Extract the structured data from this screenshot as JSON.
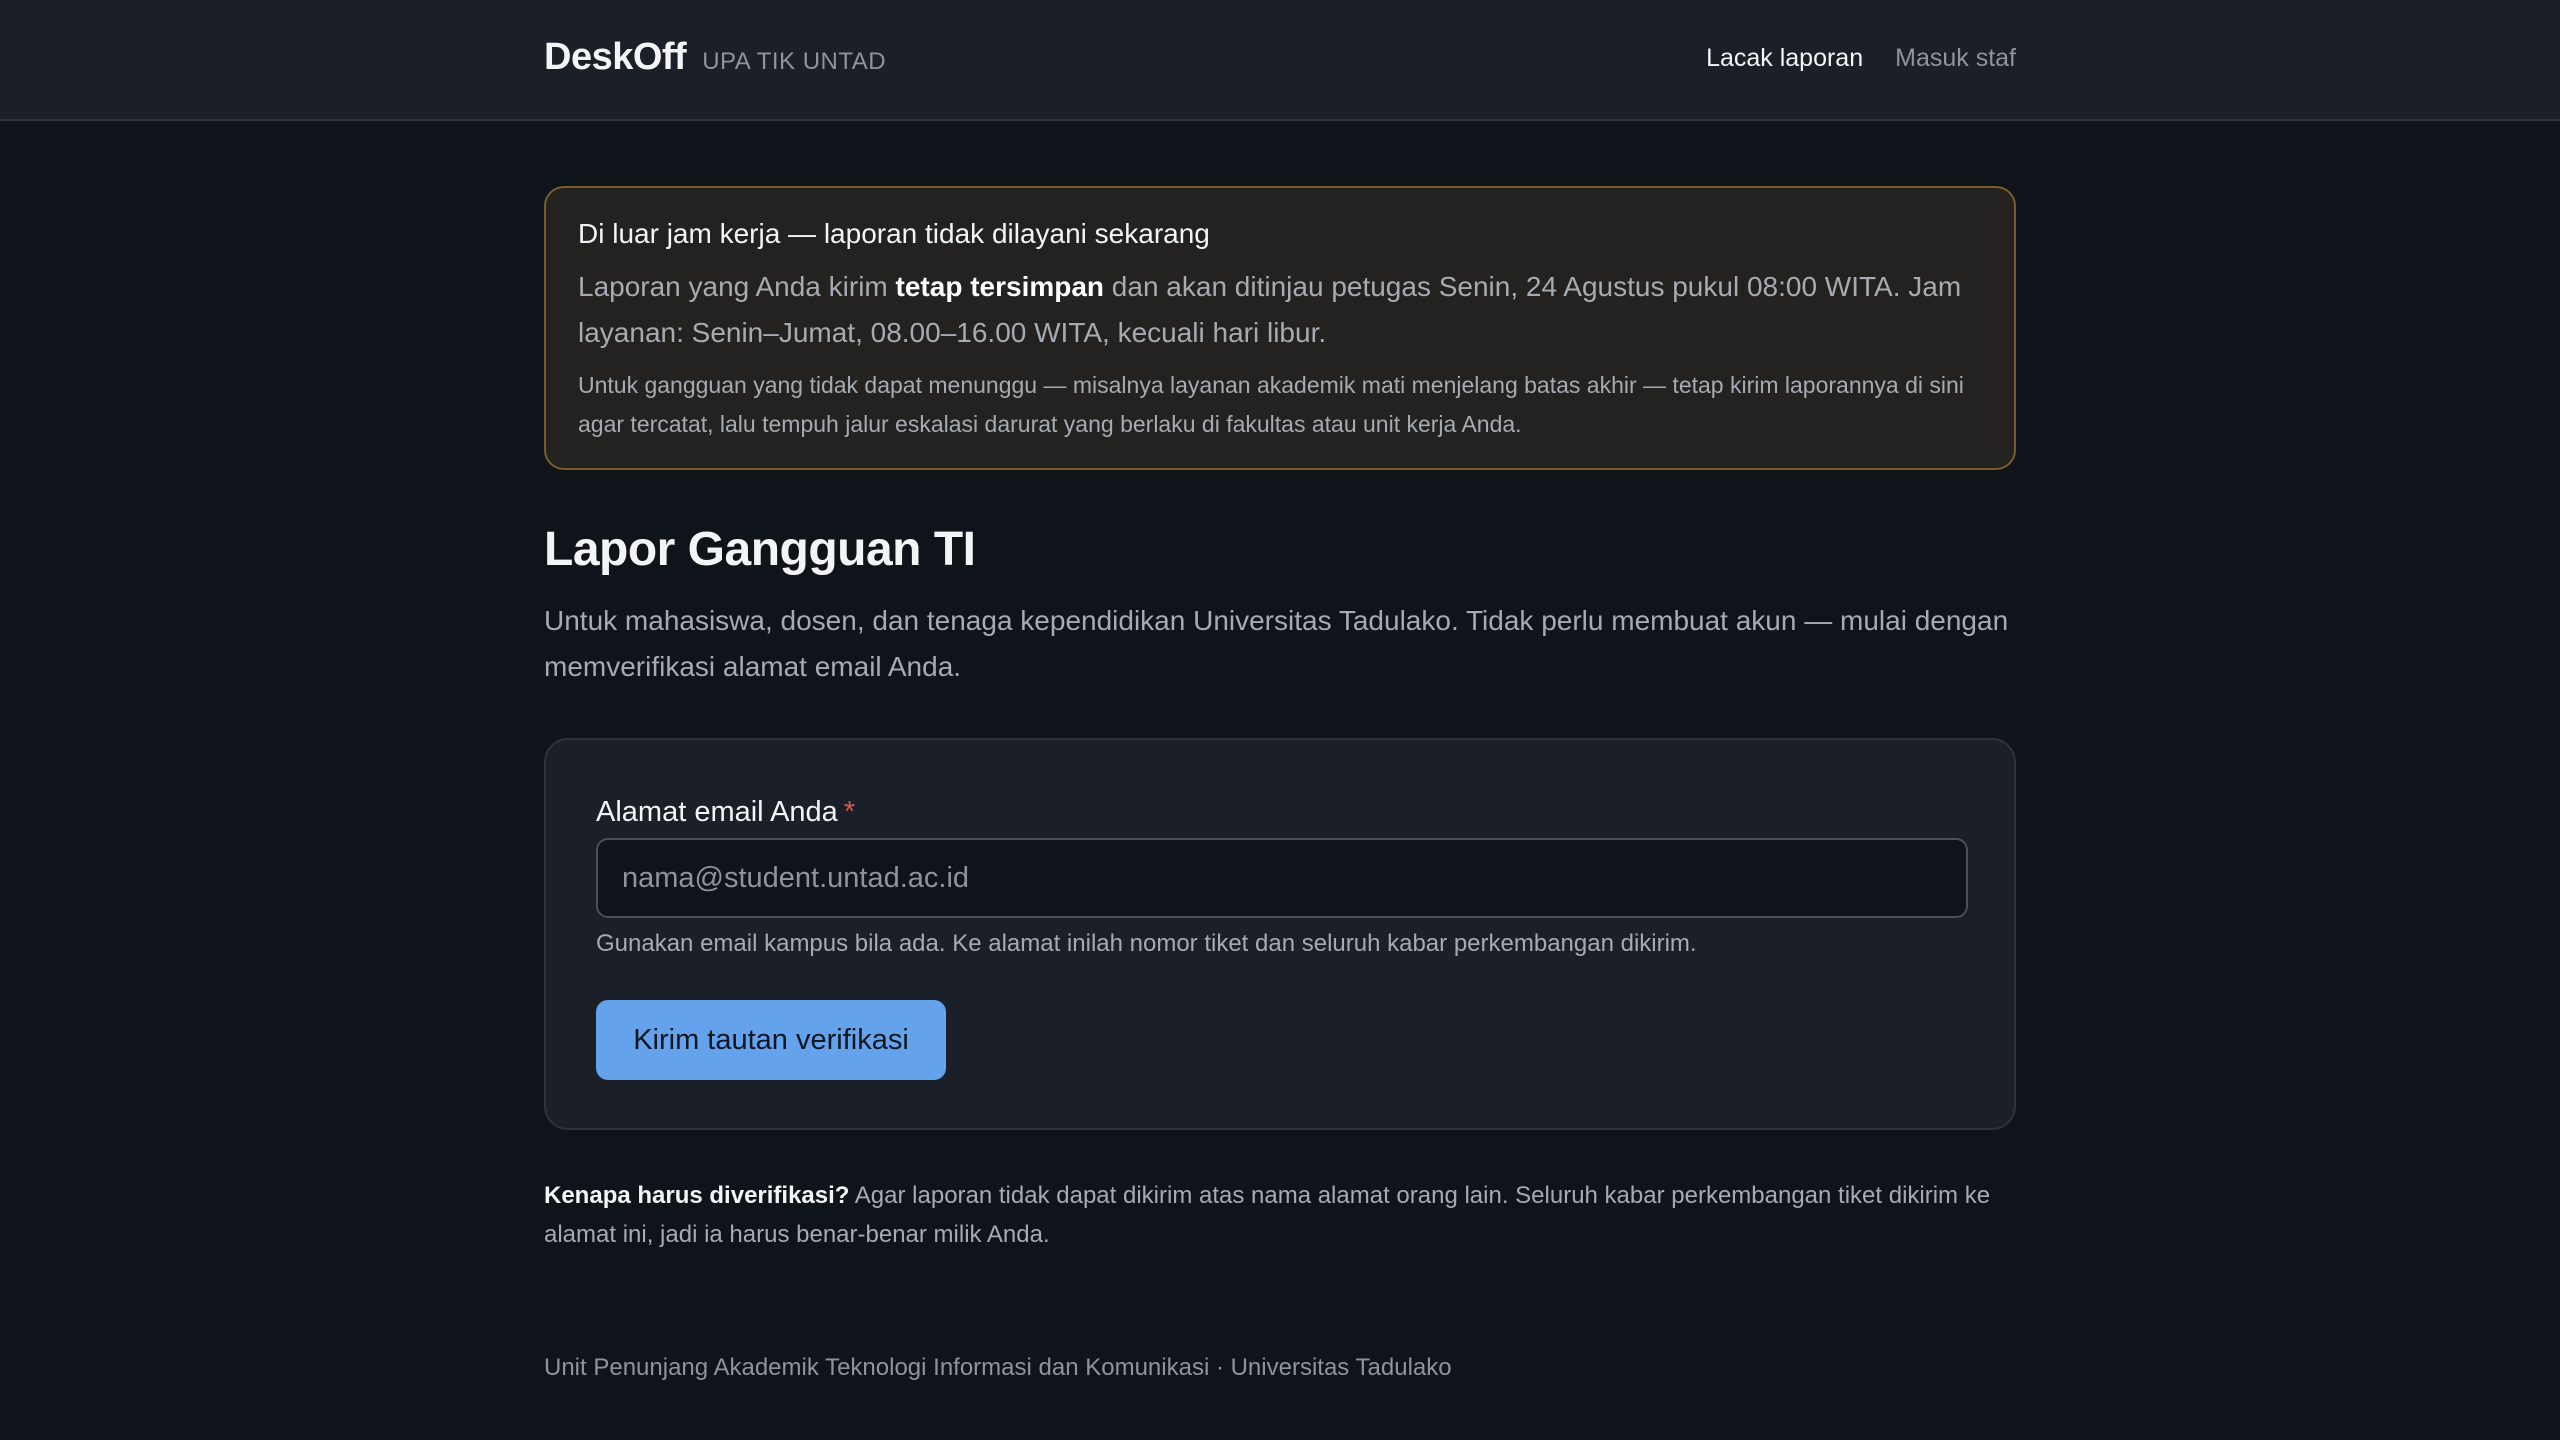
{
  "header": {
    "brand": "DeskOff",
    "brand_sub": "UPA TIK UNTAD",
    "nav": {
      "track": "Lacak laporan",
      "staff_login": "Masuk staf"
    }
  },
  "alert": {
    "title": "Di luar jam kerja — laporan tidak dilayani sekarang",
    "body_prefix": "Laporan yang Anda kirim ",
    "body_bold": "tetap tersimpan",
    "body_suffix": " dan akan ditinjau petugas Senin, 24 Agustus pukul 08:00 WITA. Jam layanan: Senin–Jumat, 08.00–16.00 WITA, kecuali hari libur.",
    "note": "Untuk gangguan yang tidak dapat menunggu — misalnya layanan akademik mati menjelang batas akhir — tetap kirim laporannya di sini agar tercatat, lalu tempuh jalur eskalasi darurat yang berlaku di fakultas atau unit kerja Anda."
  },
  "main": {
    "title": "Lapor Gangguan TI",
    "intro": "Untuk mahasiswa, dosen, dan tenaga kependidikan Universitas Tadulako. Tidak perlu membuat akun — mulai dengan memverifikasi alamat email Anda."
  },
  "form": {
    "email_label": "Alamat email Anda",
    "required_mark": "*",
    "email_value": "",
    "email_placeholder": "nama@student.untad.ac.id",
    "help": "Gunakan email kampus bila ada. Ke alamat inilah nomor tiket dan seluruh kabar perkembangan dikirim.",
    "submit_label": "Kirim tautan verifikasi"
  },
  "why": {
    "label": "Kenapa harus diverifikasi?",
    "text": " Agar laporan tidak dapat dikirim atas nama alamat orang lain. Seluruh kabar perkembangan tiket dikirim ke alamat ini, jadi ia harus benar-benar milik Anda."
  },
  "footer": {
    "text": "Unit Penunjang Akademik Teknologi Informasi dan Komunikasi · Universitas Tadulako"
  },
  "colors": {
    "background": "#0f131a",
    "header": "#1b1f27",
    "alert_border": "#7a5a2a",
    "primary_button": "#64a2ec",
    "required": "#e5534b"
  }
}
